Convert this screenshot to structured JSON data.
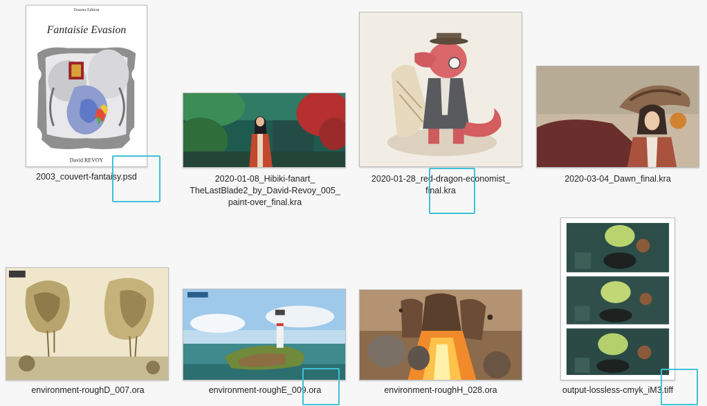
{
  "files": [
    {
      "name_lines": [
        "2003_couvert-fantaisy.psd"
      ],
      "thumbnail_text": {
        "edition": "Dossier Edition",
        "title": "Fantaisie Evasion",
        "author": "David REVOY"
      }
    },
    {
      "name_lines": [
        "2020-01-08_Hibiki-fanart_",
        "TheLastBlade2_by_David-Revoy_005_",
        "paint-over_final.kra"
      ]
    },
    {
      "name_lines": [
        "2020-01-28_red-dragon-economist_",
        "final.kra"
      ]
    },
    {
      "name_lines": [
        "2020-03-04_Dawn_final.kra"
      ]
    },
    {
      "name_lines": [
        "environment-roughD_007.ora"
      ]
    },
    {
      "name_lines": [
        "environment-roughE_009.ora"
      ]
    },
    {
      "name_lines": [
        "environment-roughH_028.ora"
      ]
    },
    {
      "name_lines": [
        "output-lossless-cmyk_iM3.tiff"
      ]
    }
  ],
  "highlight_color": "#3fc1d6"
}
